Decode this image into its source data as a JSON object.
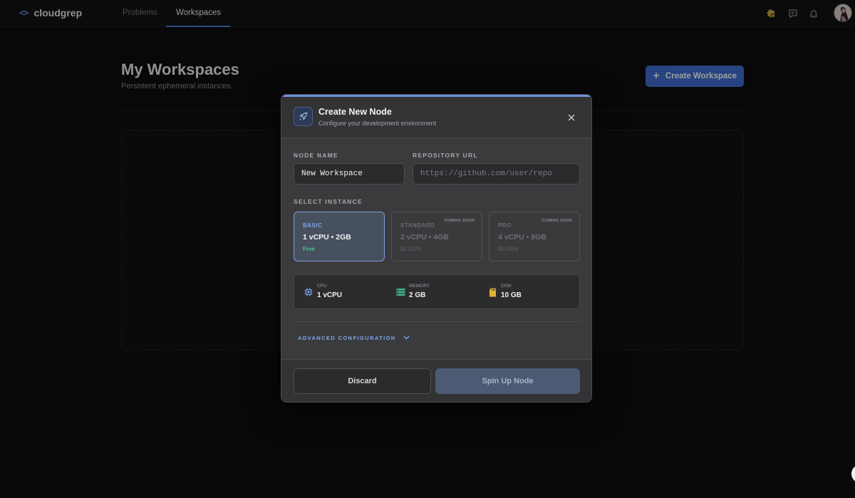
{
  "app": {
    "logo_icon": "<>",
    "name": "cloudgrep"
  },
  "nav": {
    "tabs": [
      {
        "label": "Problems",
        "active": false
      },
      {
        "label": "Workspaces",
        "active": true
      }
    ],
    "icons": [
      "badge-icon",
      "chat-icon",
      "bell-icon"
    ]
  },
  "page": {
    "title": "My Workspaces",
    "subtitle": "Persistent ephemeral instances.",
    "create_button": "Create Workspace"
  },
  "modal": {
    "title": "Create New Node",
    "subtitle": "Configure your development environment",
    "node_name": {
      "label": "NODE NAME",
      "value": "New Workspace"
    },
    "repo_url": {
      "label": "REPOSITORY URL",
      "placeholder": "https://github.com/user/repo"
    },
    "instance": {
      "label": "SELECT INSTANCE",
      "options": [
        {
          "tier": "BASIC",
          "spec": "1 vCPU • 2GB",
          "price": "Free",
          "badge": "",
          "selected": true
        },
        {
          "tier": "STANDARD",
          "spec": "2 vCPU • 4GB",
          "price": "$0.02/hr",
          "badge": "COMING SOON",
          "selected": false
        },
        {
          "tier": "PRO",
          "spec": "4 vCPU • 8GB",
          "price": "$0.05/hr",
          "badge": "COMING SOON",
          "selected": false
        }
      ]
    },
    "specs": [
      {
        "label": "CPU",
        "value": "1 vCPU",
        "icon": "cpu-icon"
      },
      {
        "label": "MEMORY",
        "value": "2 GB",
        "icon": "memory-icon"
      },
      {
        "label": "DISK",
        "value": "10 GB",
        "icon": "disk-icon"
      }
    ],
    "advanced_label": "ADVANCED CONFIGURATION",
    "discard_button": "Discard",
    "submit_button": "Spin Up Node"
  },
  "colors": {
    "accent": "#3f6fd1",
    "link": "#7ea4ec",
    "free": "#4bc48f"
  }
}
